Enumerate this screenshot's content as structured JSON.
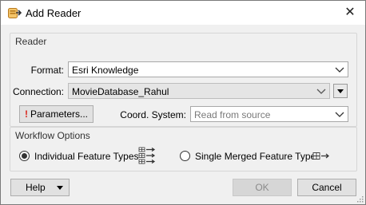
{
  "window": {
    "title": "Add Reader",
    "close_glyph": "✕"
  },
  "reader": {
    "group_title": "Reader",
    "format": {
      "label": "Format:",
      "value": "Esri Knowledge"
    },
    "connection": {
      "label": "Connection:",
      "value": "MovieDatabase_Rahul"
    },
    "parameters_button": {
      "badge": "!",
      "label": "Parameters..."
    },
    "coord_system": {
      "label": "Coord. System:",
      "placeholder": "Read from source"
    }
  },
  "workflow": {
    "group_title": "Workflow Options",
    "individual": {
      "label": "Individual Feature Types",
      "selected": true,
      "icon": "multiple-feature-types-icon"
    },
    "merged": {
      "label": "Single Merged Feature Type",
      "selected": false,
      "icon": "merged-feature-type-icon"
    }
  },
  "footer": {
    "help_label": "Help",
    "ok_label": "OK",
    "cancel_label": "Cancel"
  },
  "colors": {
    "accent_orange": "#e8a33a",
    "error_red": "#d9261c",
    "client_bg": "#f0f0f0"
  }
}
